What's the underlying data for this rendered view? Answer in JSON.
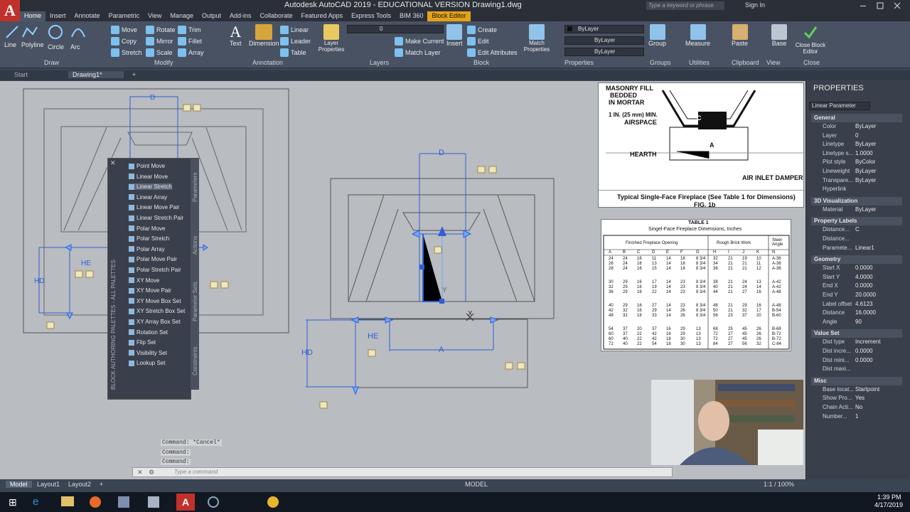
{
  "titlebar": {
    "title": "Autodesk AutoCAD 2019 - EDUCATIONAL VERSION    Drawing1.dwg",
    "search_placeholder": "Type a keyword or phrase",
    "signin": "Sign In",
    "logo": "A"
  },
  "menu_tabs": [
    "Home",
    "Insert",
    "Annotate",
    "Parametric",
    "View",
    "Manage",
    "Output",
    "Add-ins",
    "Collaborate",
    "Featured Apps",
    "Express Tools",
    "BIM 360",
    "Block Editor"
  ],
  "ribbon": {
    "draw": {
      "label": "Draw",
      "items": [
        "Line",
        "Polyline",
        "Circle",
        "Arc"
      ]
    },
    "modify": {
      "label": "Modify",
      "items": [
        "Move",
        "Rotate",
        "Trim",
        "Copy",
        "Mirror",
        "Fillet",
        "Stretch",
        "Scale",
        "Array"
      ]
    },
    "annotation": {
      "label": "Annotation",
      "items": [
        "Text",
        "Dimension",
        "Linear",
        "Leader",
        "Table"
      ]
    },
    "layers": {
      "label": "Layers",
      "items": [
        "Layer Properties",
        "Make Current",
        "Match Layer"
      ],
      "layer_value": "0"
    },
    "block": {
      "label": "Block",
      "items": [
        "Insert",
        "Create",
        "Edit",
        "Edit Attributes"
      ]
    },
    "properties": {
      "label": "Properties",
      "items": [
        "Match Properties"
      ],
      "color": "ByLayer",
      "linetype": "ByLayer",
      "lineweight": "ByLayer"
    },
    "groups": {
      "label": "Groups",
      "items": [
        "Group"
      ]
    },
    "utilities": {
      "label": "Utilities",
      "items": [
        "Measure"
      ]
    },
    "clipboard": {
      "label": "Clipboard",
      "items": [
        "Paste"
      ]
    },
    "view": {
      "label": "View",
      "items": [
        "Base"
      ]
    },
    "close": {
      "label": "Close",
      "items": [
        "Close Block Editor"
      ]
    }
  },
  "doc_tabs": [
    "Start",
    "Drawing1*"
  ],
  "palette": {
    "title": "BLOCK AUTHORING PALETTES - ALL PALETTES",
    "tabs": [
      "Parameters",
      "Actions",
      "Parameter Sets",
      "Constraints"
    ],
    "items": [
      "Point Move",
      "Linear Move",
      "Linear Stretch",
      "Linear Array",
      "Linear Move Pair",
      "Linear Stretch Pair",
      "Polar Move",
      "Polar Stretch",
      "Polar Array",
      "Polar Move Pair",
      "Polar Stretch Pair",
      "XY Move",
      "XY Move Pair",
      "XY Move Box Set",
      "XY Stretch Box Set",
      "XY Array Box Set",
      "Rotation Set",
      "Flip Set",
      "Visibility Set",
      "Lookup Set"
    ],
    "selected": "Linear Stretch"
  },
  "drawing_labels": {
    "d1": "D",
    "he1": "HE",
    "hd1": "HD",
    "d2": "D",
    "he2": "HE",
    "hd2": "HD",
    "a2": "A",
    "y": "Y",
    "x": "X"
  },
  "command": {
    "history": [
      "Command: *Cancel*",
      "Command:",
      "Command:"
    ],
    "placeholder": "Type a command"
  },
  "status": {
    "layout_tabs": [
      "Model",
      "Layout1",
      "Layout2"
    ],
    "model": "MODEL",
    "scale": "1:1 / 100%",
    "time": "1:39 PM",
    "date": "4/17/2019"
  },
  "reference1": {
    "labels": [
      "MASONRY FILL",
      "BEDDED",
      "IN MORTAR",
      "1 IN. (25 mm) MIN.",
      "AIRSPACE",
      "HEARTH",
      "AIR INLET DAMPER",
      "A",
      "C"
    ],
    "caption": "Typical Single-Face Fireplace (See Table 1 for Dimensions)",
    "fig": "FIG. 1b"
  },
  "reference2": {
    "title": "TABLE 1",
    "subtitle": "Singel-Face Fireplace Dimensions, Inches",
    "group_headers": [
      "Finished Fireplace Opening",
      "Rough Brick Work",
      "Steel Angle"
    ],
    "columns": [
      "A",
      "B",
      "C",
      "D",
      "E",
      "F",
      "G",
      "H",
      "I",
      "J",
      "K",
      "N"
    ],
    "rows": [
      [
        "24",
        "24",
        "16",
        "11",
        "14",
        "18",
        "8 3/4",
        "32",
        "21",
        "19",
        "10",
        "A-36"
      ],
      [
        "26",
        "24",
        "16",
        "13",
        "14",
        "18",
        "8 3/4",
        "34",
        "21",
        "21",
        "11",
        "A-36"
      ],
      [
        "28",
        "24",
        "16",
        "15",
        "14",
        "18",
        "8 3/4",
        "36",
        "21",
        "21",
        "12",
        "A-36"
      ],
      [
        "30",
        "29",
        "16",
        "17",
        "14",
        "23",
        "8 3/4",
        "38",
        "21",
        "24",
        "13",
        "A-42"
      ],
      [
        "32",
        "29",
        "16",
        "19",
        "14",
        "23",
        "8 3/4",
        "40",
        "21",
        "24",
        "14",
        "A-42"
      ],
      [
        "36",
        "29",
        "16",
        "22",
        "14",
        "23",
        "8 3/4",
        "44",
        "21",
        "27",
        "16",
        "A-48"
      ],
      [
        "40",
        "29",
        "16",
        "27",
        "14",
        "23",
        "8 3/4",
        "48",
        "21",
        "29",
        "16",
        "A-48"
      ],
      [
        "42",
        "32",
        "16",
        "29",
        "14",
        "26",
        "8 3/4",
        "50",
        "21",
        "32",
        "17",
        "B-54"
      ],
      [
        "48",
        "32",
        "18",
        "33",
        "14",
        "26",
        "8 3/4",
        "56",
        "23",
        "37",
        "20",
        "B-60"
      ],
      [
        "54",
        "37",
        "20",
        "37",
        "16",
        "29",
        "13",
        "68",
        "25",
        "45",
        "26",
        "B-68"
      ],
      [
        "60",
        "37",
        "22",
        "42",
        "16",
        "29",
        "13",
        "72",
        "27",
        "45",
        "26",
        "B-72"
      ],
      [
        "60",
        "40",
        "22",
        "42",
        "18",
        "30",
        "13",
        "72",
        "27",
        "45",
        "26",
        "B-72"
      ],
      [
        "72",
        "40",
        "22",
        "54",
        "18",
        "30",
        "13",
        "84",
        "27",
        "56",
        "32",
        "C-84"
      ]
    ]
  },
  "properties": {
    "title": "PROPERTIES",
    "selector": "Linear Parameter",
    "sections": [
      {
        "name": "General",
        "rows": [
          [
            "Color",
            "ByLayer"
          ],
          [
            "Layer",
            "0"
          ],
          [
            "Linetype",
            "ByLayer"
          ],
          [
            "Linetype s...",
            "1.0000"
          ],
          [
            "Plot style",
            "ByColor"
          ],
          [
            "Lineweight",
            "ByLayer"
          ],
          [
            "Transpare...",
            "ByLayer"
          ],
          [
            "Hyperlink",
            ""
          ]
        ]
      },
      {
        "name": "3D Visualization",
        "rows": [
          [
            "Material",
            "ByLayer"
          ]
        ]
      },
      {
        "name": "Property Labels",
        "rows": [
          [
            "Distance...",
            "C"
          ],
          [
            "Distance...",
            ""
          ],
          [
            "Paramete...",
            "Linear1"
          ]
        ]
      },
      {
        "name": "Geometry",
        "rows": [
          [
            "Start X",
            "0.0000"
          ],
          [
            "Start Y",
            "4.0000"
          ],
          [
            "End X",
            "0.0000"
          ],
          [
            "End Y",
            "20.0000"
          ],
          [
            "Label offset",
            "4.6123"
          ],
          [
            "Distance",
            "16.0000"
          ],
          [
            "Angle",
            "90"
          ]
        ]
      },
      {
        "name": "Value Set",
        "rows": [
          [
            "Dist type",
            "Increment"
          ],
          [
            "Dist incre...",
            "0.0000"
          ],
          [
            "Dist mini...",
            "0.0000"
          ],
          [
            "Dist maxi...",
            ""
          ]
        ]
      },
      {
        "name": "Misc",
        "rows": [
          [
            "Base locat...",
            "Startpoint"
          ],
          [
            "Show Pro...",
            "Yes"
          ],
          [
            "Chain Acti...",
            "No"
          ],
          [
            "Number...",
            "1"
          ]
        ]
      }
    ]
  },
  "colors": {
    "accent": "#e3a317",
    "param_blue": "#2e5fd6",
    "canvas": "#b9bcc1"
  }
}
